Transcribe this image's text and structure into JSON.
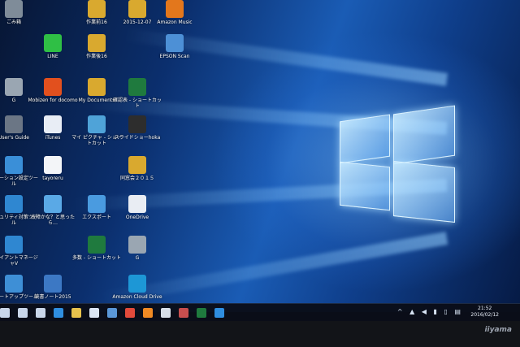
{
  "desktop": {
    "icons": [
      {
        "label": "ごみ箱",
        "icon": "recycle-bin-icon",
        "color": "#7f8c99"
      },
      {
        "label": "作業前16",
        "icon": "folder-icon",
        "color": "#d9a92f"
      },
      {
        "label": "2015-12-07",
        "icon": "folder-icon",
        "color": "#d9a92f"
      },
      {
        "label": "Amazon Music",
        "icon": "amazon-music-icon",
        "color": "#e3771c"
      },
      {
        "label": "LINE",
        "icon": "line-app-icon",
        "color": "#2fbf45"
      },
      {
        "label": "作業後16",
        "icon": "folder-icon",
        "color": "#d9a92f"
      },
      {
        "label": "EPSON Scan",
        "icon": "scanner-icon",
        "color": "#4d90d6"
      },
      {
        "label": "G",
        "icon": "drive-icon",
        "color": "#9aa6b2"
      },
      {
        "label": "Mobizen for docomo",
        "icon": "mobizen-icon",
        "color": "#e2501e"
      },
      {
        "label": "My Documents",
        "icon": "documents-folder-icon",
        "color": "#d9a92f"
      },
      {
        "label": "確認表 - ショートカット",
        "icon": "excel-shortcut-icon",
        "color": "#1f7a3e"
      },
      {
        "label": "User's Guide",
        "icon": "help-icon",
        "color": "#6b7685"
      },
      {
        "label": "iTunes",
        "icon": "itunes-icon",
        "color": "#e8edf5"
      },
      {
        "label": "マイ ピクチャ - ショートカット",
        "icon": "pictures-shortcut-icon",
        "color": "#4fa3d8"
      },
      {
        "label": "スライドショーhoka",
        "icon": "slideshow-icon",
        "color": "#2d2d2d"
      },
      {
        "label": "ステーション設定ツール",
        "icon": "station-settings-icon",
        "color": "#3a8fd8"
      },
      {
        "label": "tayoreru",
        "icon": "tayoreru-icon",
        "color": "#f3f5f8"
      },
      {
        "label": "同窓会２０１５",
        "icon": "folder-icon",
        "color": "#d9a92f"
      },
      {
        "label": "セキュリティ対策ツール",
        "icon": "security-tool-icon",
        "color": "#2f87d1"
      },
      {
        "label": "故障かな？と思ったら…",
        "icon": "troubleshoot-icon",
        "color": "#5aa9e6"
      },
      {
        "label": "エクスポート",
        "icon": "export-icon",
        "color": "#4a9be0"
      },
      {
        "label": "OneDrive",
        "icon": "onedrive-icon",
        "color": "#e9edf3"
      },
      {
        "label": "クライアントマネージャV",
        "icon": "wifi-manager-icon",
        "color": "#2f87d1"
      },
      {
        "label": "多数 - ショートカット",
        "icon": "excel-shortcut-icon",
        "color": "#1f7a3e"
      },
      {
        "label": "G",
        "icon": "drive-icon",
        "color": "#9aa6b2"
      },
      {
        "label": "スタートアップツール",
        "icon": "startup-tool-icon",
        "color": "#3e8fd6"
      },
      {
        "label": "読書ノート2015",
        "icon": "notebook-icon",
        "color": "#3c78c4"
      },
      {
        "label": "Amazon Cloud Drive",
        "icon": "cloud-drive-icon",
        "color": "#1d97d6"
      }
    ]
  },
  "taskbar": {
    "start": {
      "icon": "windows-logo-icon"
    },
    "pinned": [
      {
        "name": "search-icon",
        "color": "#c9d6ea"
      },
      {
        "name": "task-view-icon",
        "color": "#c9d6ea"
      },
      {
        "name": "edge-icon",
        "color": "#2f8ee0"
      },
      {
        "name": "file-explorer-icon",
        "color": "#e8c24d"
      },
      {
        "name": "store-icon",
        "color": "#dce6f4"
      },
      {
        "name": "photos-icon",
        "color": "#5a97d8"
      },
      {
        "name": "chrome-icon",
        "color": "#e24a3b"
      },
      {
        "name": "firefox-icon",
        "color": "#f08a24"
      },
      {
        "name": "media-icon",
        "color": "#d8dfe9"
      },
      {
        "name": "mail-icon",
        "color": "#c74e4e"
      },
      {
        "name": "excel-icon",
        "color": "#1f7a3e"
      },
      {
        "name": "onedrive-icon",
        "color": "#2f8ee0"
      }
    ],
    "tray_icons": "^ ▲ ◀ ▮ ▯ ▤",
    "clock_time": "21:52",
    "clock_date": "2016/02/12"
  },
  "monitor": {
    "brand": "iiyama"
  }
}
